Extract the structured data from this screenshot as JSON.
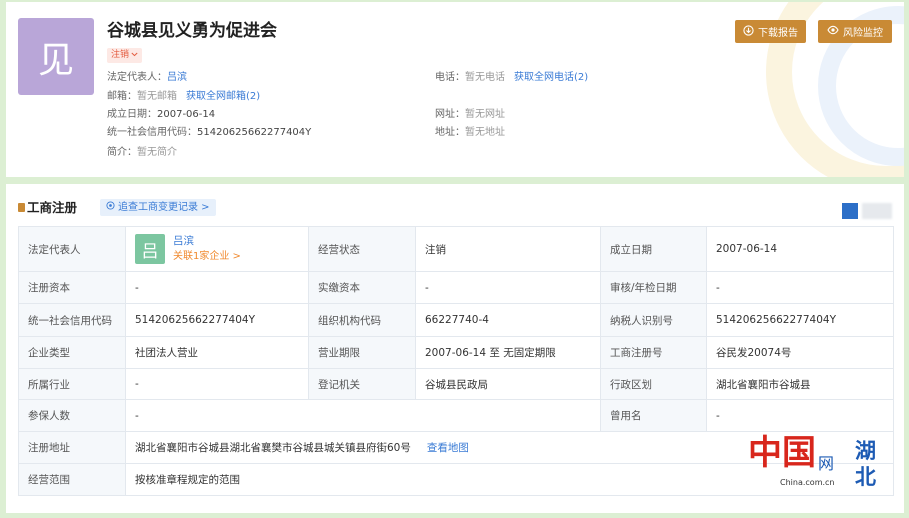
{
  "header": {
    "avatar": "见",
    "title": "谷城县见义勇为促进会",
    "status": "注销",
    "legal_rep_label": "法定代表人：",
    "legal_rep": "吕滨",
    "phone_label": "电话：",
    "phone": "暂无电话",
    "phone_link": "获取全网电话(2)",
    "email_label": "邮箱：",
    "email": "暂无邮箱",
    "email_link": "获取全网邮箱(2)",
    "founded_label": "成立日期：",
    "founded": "2007-06-14",
    "website_label": "网址：",
    "website": "暂无网址",
    "credit_code_label": "统一社会信用代码：",
    "credit_code": "51420625662277404Y",
    "address_label": "地址：",
    "address": "暂无地址",
    "intro_label": "简介：",
    "intro": "暂无简介"
  },
  "actions": {
    "download": {
      "label": "下载报告",
      "icon": "download-icon"
    },
    "monitor": {
      "label": "风险监控",
      "icon": "eye-icon"
    }
  },
  "registration": {
    "title": "工商注册",
    "trace_link": "追查工商变更记录 >",
    "legal_rep": {
      "avatar": "吕",
      "name": "吕滨",
      "related": "关联1家企业 >"
    },
    "rows": [
      [
        {
          "label": "法定代表人"
        },
        {
          "label": "经营状态",
          "value": "注销"
        },
        {
          "label": "成立日期",
          "value": "2007-06-14"
        }
      ],
      [
        {
          "label": "注册资本",
          "value": "-"
        },
        {
          "label": "实缴资本",
          "value": "-"
        },
        {
          "label": "审核/年检日期",
          "value": "-"
        }
      ],
      [
        {
          "label": "统一社会信用代码",
          "value": "51420625662277404Y"
        },
        {
          "label": "组织机构代码",
          "value": "66227740-4"
        },
        {
          "label": "纳税人识别号",
          "value": "51420625662277404Y"
        }
      ],
      [
        {
          "label": "企业类型",
          "value": "社团法人营业"
        },
        {
          "label": "营业期限",
          "value": "2007-06-14 至 无固定期限"
        },
        {
          "label": "工商注册号",
          "value": "谷民发20074号"
        }
      ],
      [
        {
          "label": "所属行业",
          "value": "-"
        },
        {
          "label": "登记机关",
          "value": "谷城县民政局"
        },
        {
          "label": "行政区划",
          "value": "湖北省襄阳市谷城县"
        }
      ],
      [
        {
          "label": "参保人数",
          "value": "-"
        },
        {
          "label": "曾用名",
          "value": "-"
        }
      ],
      [
        {
          "label": "注册地址",
          "value": "湖北省襄阳市谷城县湖北省襄樊市谷城县城关镇县府街60号",
          "link": "查看地图"
        }
      ],
      [
        {
          "label": "经营范围",
          "value": "按核准章程规定的范围"
        }
      ]
    ]
  },
  "watermark": {
    "brand": "中国",
    "net": "网",
    "domain": "China.com.cn",
    "region": "湖北"
  },
  "colors": {
    "page_bg": "#dcefd3",
    "accent": "#3a7bd5",
    "button": "#c98a35",
    "status_red": "#e45b3f",
    "avatar_purple": "#b9a6d8",
    "avatar_green": "#7cc6a0",
    "related_orange": "#f0892e",
    "logo_red": "#d8261c",
    "logo_blue": "#1d5bb4"
  }
}
